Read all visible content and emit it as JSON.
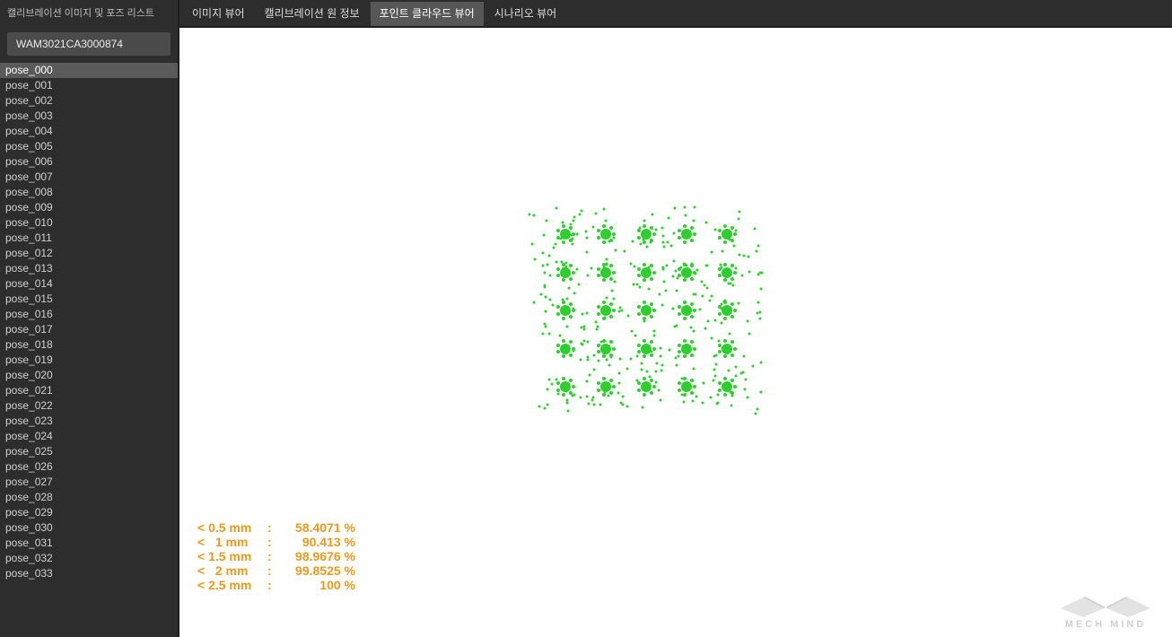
{
  "sidebar": {
    "title": "캘리브레이션 이미지 및 포즈 리스트",
    "device_id": "WAM3021CA3000874",
    "selectedPoseIndex": 0,
    "poses": [
      "pose_000",
      "pose_001",
      "pose_002",
      "pose_003",
      "pose_004",
      "pose_005",
      "pose_006",
      "pose_007",
      "pose_008",
      "pose_009",
      "pose_010",
      "pose_011",
      "pose_012",
      "pose_013",
      "pose_014",
      "pose_015",
      "pose_016",
      "pose_017",
      "pose_018",
      "pose_019",
      "pose_020",
      "pose_021",
      "pose_022",
      "pose_023",
      "pose_024",
      "pose_025",
      "pose_026",
      "pose_027",
      "pose_028",
      "pose_029",
      "pose_030",
      "pose_031",
      "pose_032",
      "pose_033"
    ]
  },
  "tabs": {
    "activeIndex": 2,
    "items": [
      "이미지 뷰어",
      "캘리브레이션 원 정보",
      "포인트 클라우드 뷰어",
      "시나리오 뷰어"
    ]
  },
  "stats": [
    {
      "label": "< 0.5 mm",
      "value": "58.4071 %"
    },
    {
      "label": "<   1 mm",
      "value": "90.413 %"
    },
    {
      "label": "< 1.5 mm",
      "value": "98.9676 %"
    },
    {
      "label": "<   2 mm",
      "value": "99.8525 %"
    },
    {
      "label": "< 2.5 mm",
      "value": "100 %"
    }
  ],
  "logo": {
    "text": "MECH MIND"
  },
  "pointcloud": {
    "grid": {
      "cols": 5,
      "rows": 5,
      "big_radius_px": 6,
      "color": "#2fce2f"
    },
    "ring": {
      "radius_px": 9,
      "count": 7,
      "dot_radius_px": 2
    },
    "scatter": {
      "count": 320,
      "dot_radius_px": 1.5,
      "seed": 42
    }
  }
}
